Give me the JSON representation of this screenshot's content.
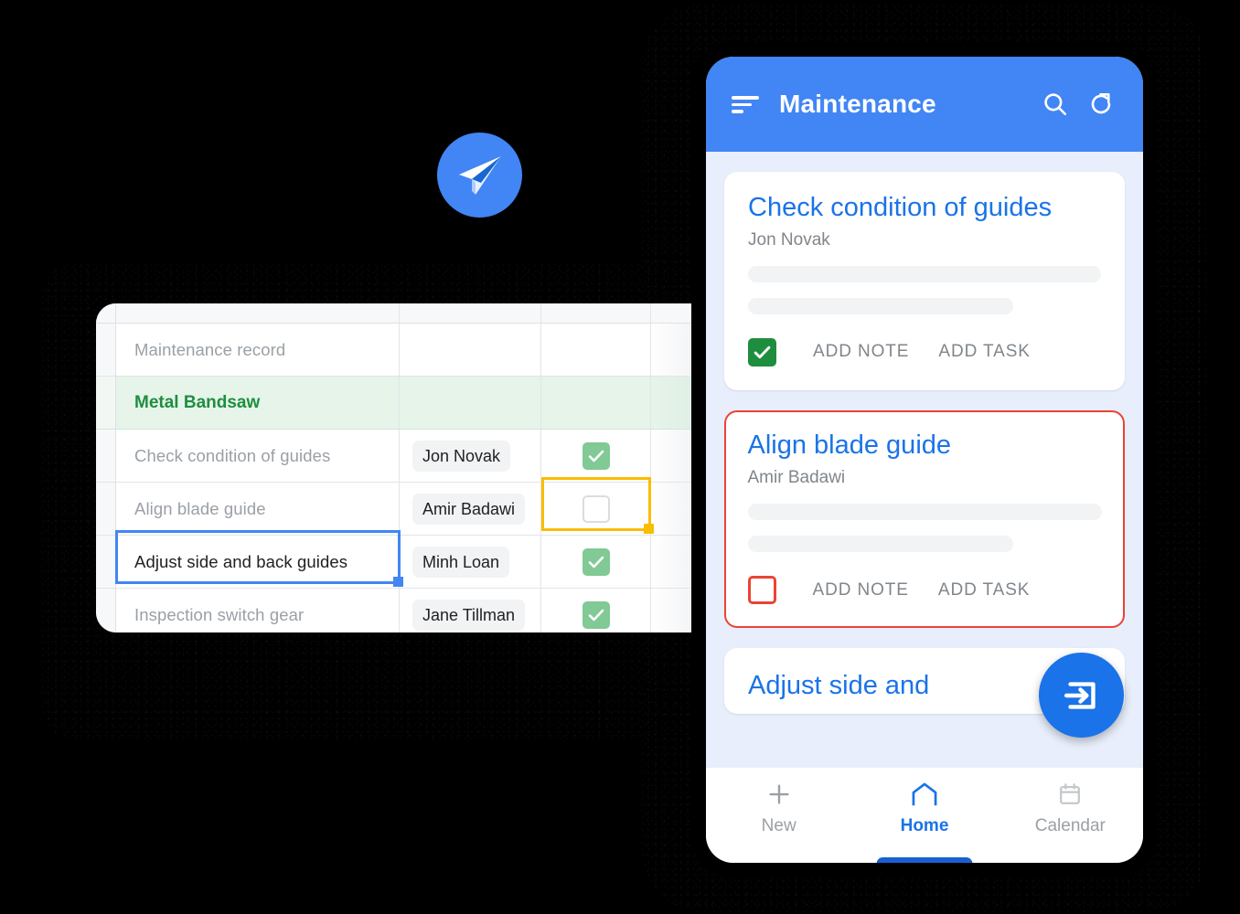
{
  "colors": {
    "app_bar_blue": "#4285F4",
    "accent_blue": "#1A73E8",
    "page_bg": "#E8EEFB",
    "flag_red": "#EA4335",
    "check_green": "#1E8E3E",
    "grid_check_green": "#81C995",
    "banner_green_bg": "#E6F4EA",
    "banner_green_text": "#1E8E3E",
    "selection_amber": "#FBBC04",
    "selection_blue": "#4285F4",
    "canvas_black": "#000000"
  },
  "logo": {
    "icon": "paper-plane-send-icon"
  },
  "spreadsheet": {
    "columns": [
      "",
      "task",
      "owner",
      "done",
      ""
    ],
    "rows": [
      {
        "kind": "plain",
        "task": "Maintenance record",
        "owner": "",
        "done": null
      },
      {
        "kind": "banner",
        "task": "Metal Bandsaw",
        "owner": "",
        "done": null
      },
      {
        "kind": "plain",
        "task": "Check condition of guides",
        "owner": "Jon Novak",
        "done": true
      },
      {
        "kind": "plain",
        "task": "Align blade guide",
        "owner": "Amir Badawi",
        "done": false
      },
      {
        "kind": "plain",
        "task": "Adjust side and back guides",
        "owner": "Minh Loan",
        "done": true
      },
      {
        "kind": "plain",
        "task": "Inspection switch gear",
        "owner": "Jane Tillman",
        "done": true
      }
    ],
    "selection": {
      "amber_cell": "Align blade guide / done",
      "blue_cell": "Adjust side and back guides"
    }
  },
  "phone": {
    "app_bar": {
      "title": "Maintenance",
      "menu_icon": "sort-menu-icon",
      "search_icon": "search-icon",
      "refresh_icon": "refresh-icon"
    },
    "cards": [
      {
        "title": "Check condition of guides",
        "owner": "Jon Novak",
        "checked": true,
        "flagged": false,
        "checkbox_icon": "checkbox-checked-icon",
        "actions": [
          "ADD NOTE",
          "ADD TASK"
        ]
      },
      {
        "title": "Align blade guide",
        "owner": "Amir Badawi",
        "checked": false,
        "flagged": true,
        "checkbox_icon": "checkbox-empty-icon",
        "actions": [
          "ADD NOTE",
          "ADD TASK"
        ]
      },
      {
        "title": "Adjust side and",
        "owner": "",
        "checked": null,
        "flagged": false,
        "checkbox_icon": "",
        "actions": []
      }
    ],
    "fab": {
      "icon": "login-input-icon"
    },
    "bottom_nav": {
      "items": [
        {
          "label": "New",
          "icon": "plus-icon",
          "active": false
        },
        {
          "label": "Home",
          "icon": "home-icon",
          "active": true
        },
        {
          "label": "Calendar",
          "icon": "calendar-icon",
          "active": false
        }
      ]
    }
  }
}
